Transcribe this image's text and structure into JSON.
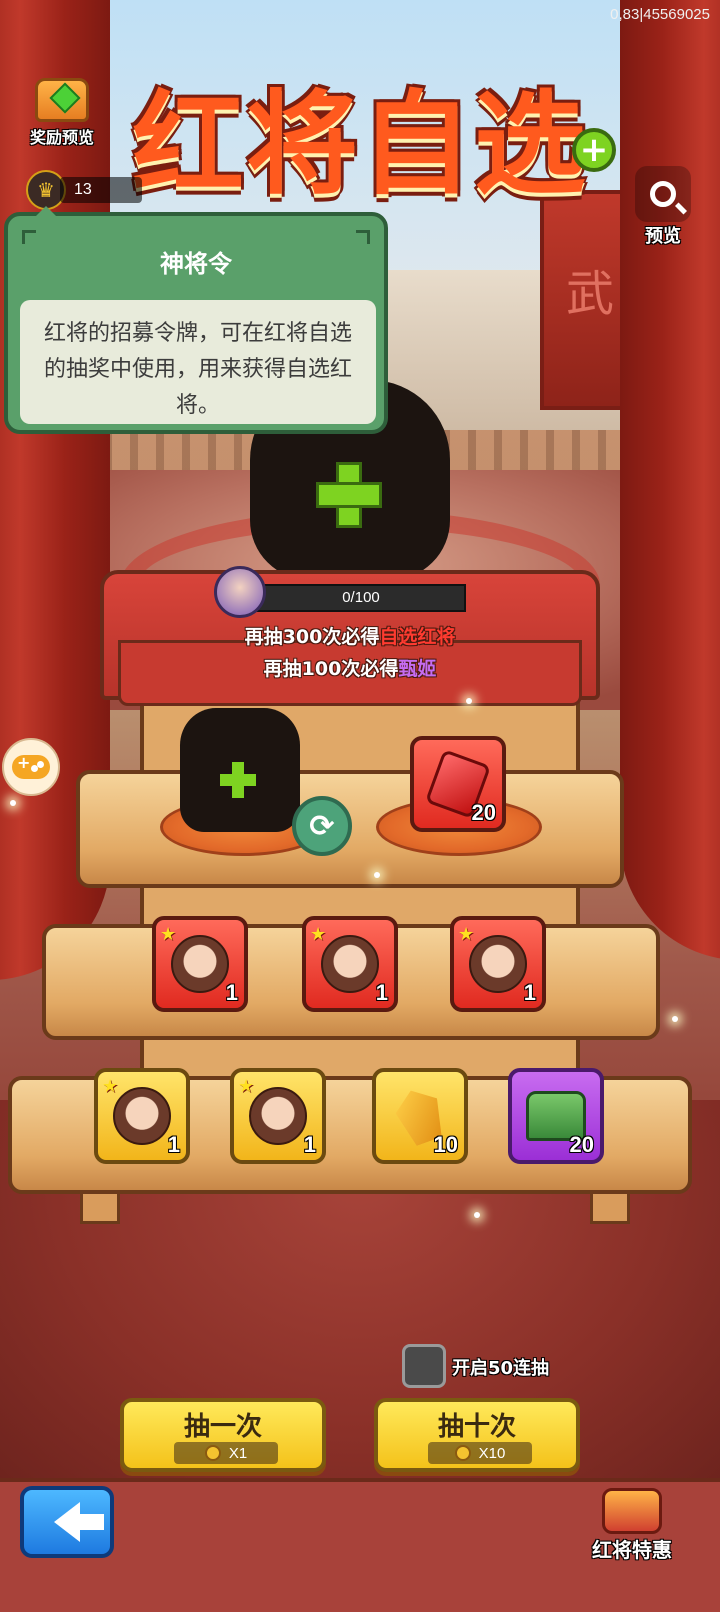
{
  "header": {
    "version": "0,83|45569025",
    "title": "红将自选",
    "reward_preview_label": "奖励预览",
    "preview_label": "预览",
    "token_count": "13"
  },
  "tooltip": {
    "title": "神将令",
    "description": "红将的招募令牌，可在红将自选的抽奖中使用，用来获得自选红将。"
  },
  "pity": {
    "progress_text": "0/100",
    "progress_value": 0,
    "line1_prefix": "再抽300次必得",
    "line1_highlight": "自选红将",
    "line2_prefix": "再抽100次必得",
    "line2_highlight": "甄姬"
  },
  "shelf_mid": {
    "reward_count": "20"
  },
  "shelf_row2": [
    {
      "count": "1"
    },
    {
      "count": "1"
    },
    {
      "count": "1"
    }
  ],
  "shelf_row3": [
    {
      "count": "1"
    },
    {
      "count": "1"
    },
    {
      "count": "10"
    },
    {
      "count": "20"
    }
  ],
  "controls": {
    "open50_label": "开启50连抽",
    "draw_one_label": "抽一次",
    "draw_one_cost": "X1",
    "draw_ten_label": "抽十次",
    "draw_ten_cost": "X10",
    "special_label": "红将特惠"
  },
  "colors": {
    "accent_red": "#ff3b30",
    "accent_purple": "#c56cf0",
    "button_yellow": "#f4c21a",
    "back_blue": "#1e7ae0"
  }
}
